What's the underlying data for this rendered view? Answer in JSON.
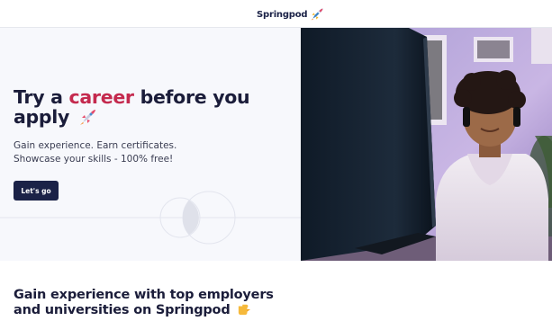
{
  "header": {
    "logo_text": "Springpod",
    "logo_icon": "rocket-icon"
  },
  "hero": {
    "title_part1": "Try a ",
    "title_accent": "career",
    "title_part2": " before you apply",
    "subtitle_line1": "Gain experience. Earn certificates.",
    "subtitle_line2": "Showcase your skills - 100% free!",
    "cta_label": "Let's go",
    "image_icon": "student-at-computer-photo"
  },
  "section": {
    "title": "Gain experience with top employers and universities on Springpod",
    "title_icon": "pointing-hand-icon"
  },
  "colors": {
    "brand_navy": "#1b2247",
    "accent_red": "#c42a4e",
    "hero_bg": "#f7f8fc"
  }
}
